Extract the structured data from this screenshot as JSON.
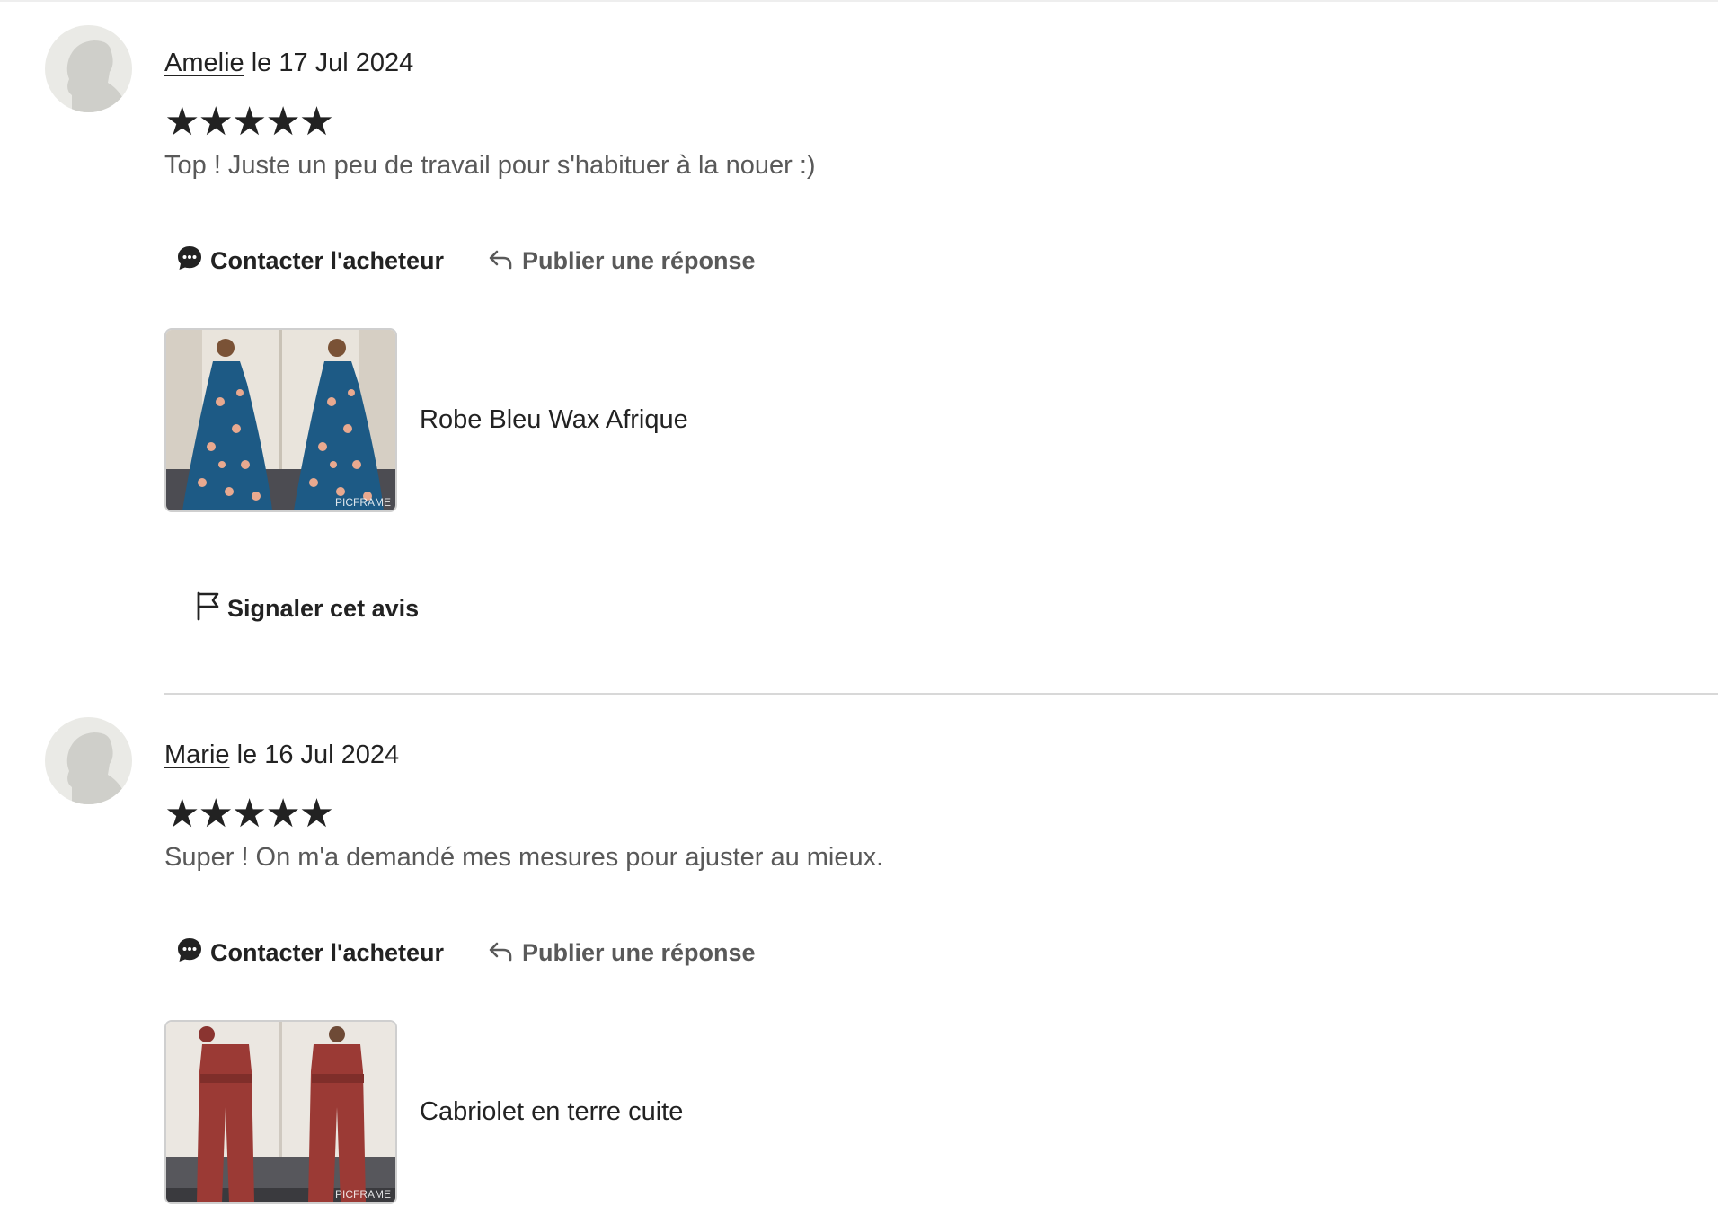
{
  "reviews": [
    {
      "reviewer": "Amelie",
      "date": "le 17 Jul 2024",
      "rating": 5,
      "stars": "★★★★★",
      "comment": "Top ! Juste un peu de travail pour s'habituer à la nouer :)",
      "contact_label": "Contacter l'acheteur",
      "reply_label": "Publier une réponse",
      "listing_title": "Robe Bleu Wax Afrique",
      "watermark": "PICFRAME",
      "report_label": "Signaler cet avis"
    },
    {
      "reviewer": "Marie",
      "date": "le 16 Jul 2024",
      "rating": 5,
      "stars": "★★★★★",
      "comment": "Super ! On m'a demandé mes mesures pour ajuster au mieux.",
      "contact_label": "Contacter l'acheteur",
      "reply_label": "Publier une réponse",
      "listing_title": "Cabriolet en terre cuite",
      "watermark": "PICFRAME"
    }
  ],
  "colors": {
    "text": "#222222",
    "muted": "#595959",
    "divider": "#d8d8d8",
    "dress_blue": "#1d5a85",
    "dress_terracotta": "#9b3a35"
  },
  "icons": {
    "contact": "chat-bubble-icon",
    "reply": "reply-arrow-icon",
    "report": "flag-icon",
    "avatar": "default-user-silhouette"
  }
}
